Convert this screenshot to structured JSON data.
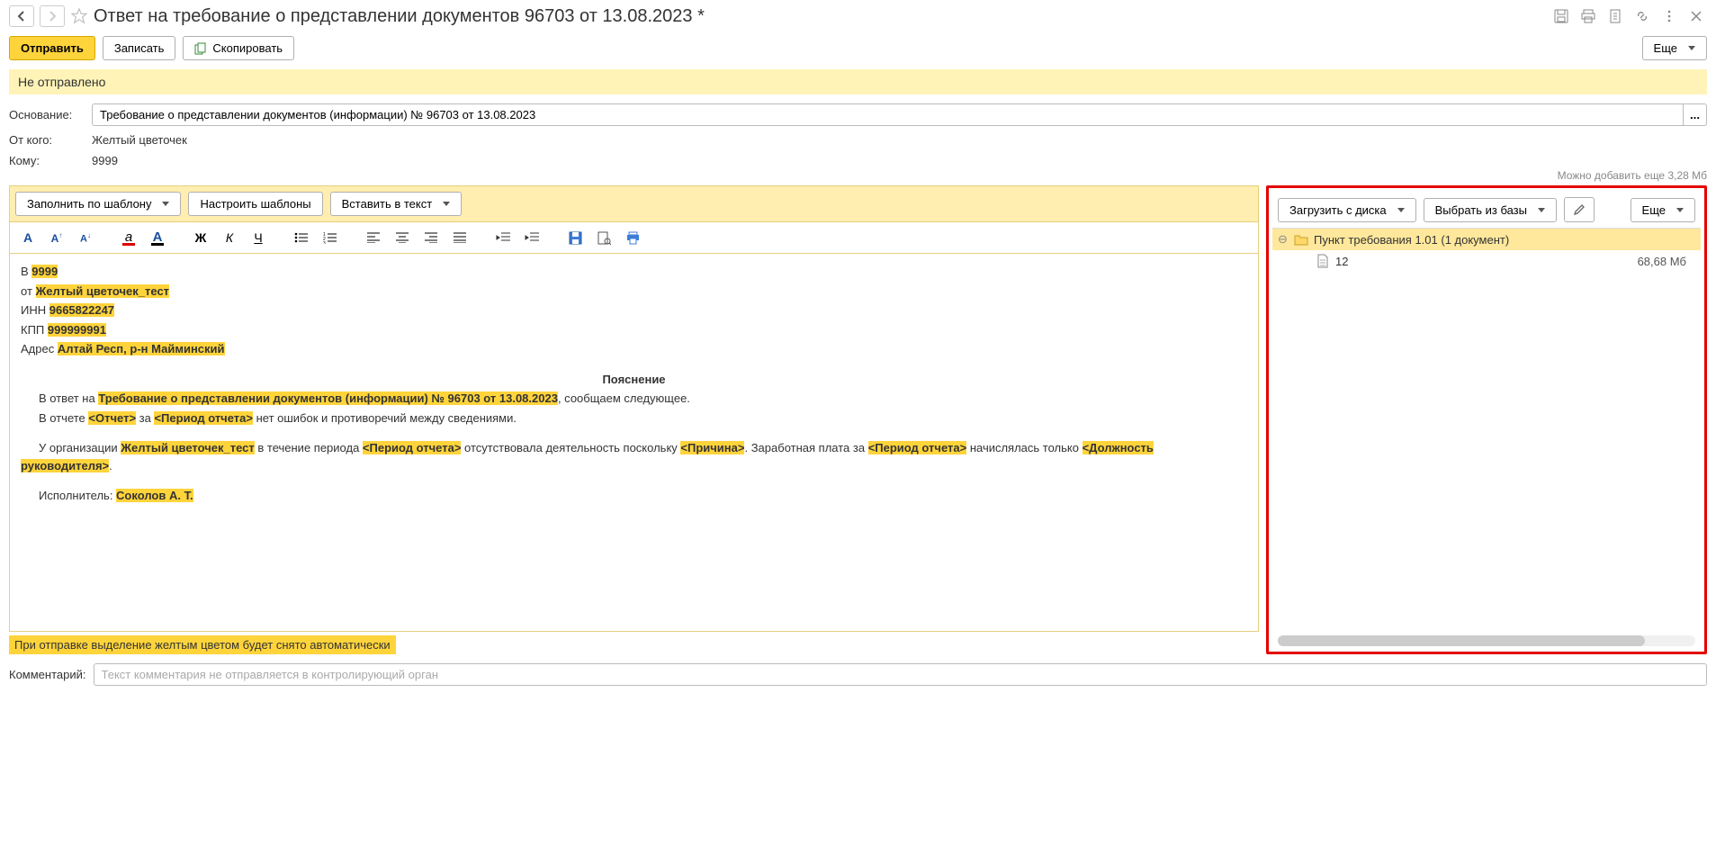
{
  "header": {
    "title": "Ответ на требование о представлении документов 96703 от 13.08.2023 *"
  },
  "actions": {
    "send": "Отправить",
    "save": "Записать",
    "copy": "Скопировать",
    "more": "Еще"
  },
  "status": "Не отправлено",
  "fields": {
    "basis_label": "Основание:",
    "basis_value": "Требование о представлении документов (информации) № 96703 от 13.08.2023",
    "from_label": "От кого:",
    "from_value": "Желтый цветочек",
    "to_label": "Кому:",
    "to_value": "9999"
  },
  "attach_hint": "Можно добавить еще 3,28 Мб",
  "editor_toolbar": {
    "fill_template": "Заполнить по шаблону",
    "configure_templates": "Настроить шаблоны",
    "insert_text": "Вставить в текст"
  },
  "editor": {
    "line_v": "В ",
    "v_val": "9999",
    "line_from": "от ",
    "from_val": "Желтый цветочек_тест",
    "line_inn": "ИНН ",
    "inn_val": "9665822247",
    "line_kpp": "КПП ",
    "kpp_val": "999999991",
    "line_addr": "Адрес ",
    "addr_val": "Алтай Респ, р-н Майминский",
    "title": "Пояснение",
    "p1_a": "В ответ на ",
    "p1_hl": "Требование о представлении документов (информации) № 96703 от 13.08.2023",
    "p1_b": ", сообщаем следующее.",
    "p2_a": "В отчете ",
    "p2_hl1": "<Отчет>",
    "p2_b": " за ",
    "p2_hl2": "<Период отчета>",
    "p2_c": " нет ошибок и противоречий между сведениями.",
    "p3_a": "У организации ",
    "p3_hl1": "Желтый цветочек_тест",
    "p3_b": " в течение периода ",
    "p3_hl2": "<Период отчета>",
    "p3_c": " отсутствовала деятельность поскольку ",
    "p3_hl3": "<Причина>",
    "p3_d": ". Заработная плата за ",
    "p3_hl4": "<Период отчета>",
    "p3_e": " начислялась только ",
    "p3_hl5": "<Должность руководителя>",
    "p3_f": ".",
    "p4_a": "Исполнитель: ",
    "p4_hl": "Соколов А. Т."
  },
  "notice": "При отправке выделение желтым цветом будет снято автоматически",
  "comment": {
    "label": "Комментарий:",
    "placeholder": "Текст комментария не отправляется в контролирующий орган"
  },
  "attachments": {
    "load_disk": "Загрузить с диска",
    "select_base": "Выбрать из базы",
    "more": "Еще",
    "folder": "Пункт требования 1.01 (1 документ)",
    "file_name": "12",
    "file_size": "68,68 Мб"
  }
}
